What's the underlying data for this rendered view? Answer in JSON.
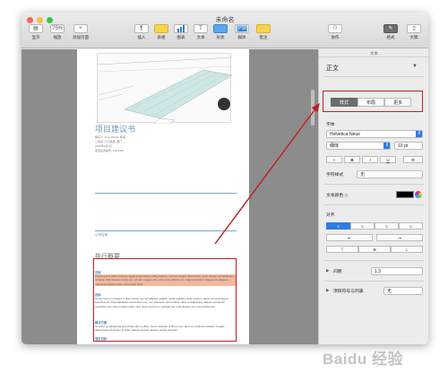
{
  "window": {
    "title": "未命名"
  },
  "toolbar": {
    "left": [
      {
        "label": "显示",
        "icon": "sidebar-icon"
      },
      {
        "label": "缩放",
        "value": "75%",
        "icon": "zoom-select-icon"
      },
      {
        "label": "添加页面",
        "icon": "plus-icon"
      }
    ],
    "center": [
      {
        "label": "插入",
        "icon": "paragraph-icon",
        "glyph": "¶"
      },
      {
        "label": "表格",
        "icon": "table-icon"
      },
      {
        "label": "图表",
        "icon": "chart-icon"
      },
      {
        "label": "文本",
        "icon": "text-icon",
        "glyph": "T"
      },
      {
        "label": "形状",
        "icon": "shape-icon"
      },
      {
        "label": "媒体",
        "icon": "media-icon"
      },
      {
        "label": "批注",
        "icon": "comment-icon"
      }
    ],
    "right": [
      {
        "label": "协作",
        "icon": "collaborate-icon"
      },
      {
        "label": "格式",
        "icon": "format-brush-icon"
      },
      {
        "label": "文稿",
        "icon": "document-icon"
      }
    ]
  },
  "document": {
    "title": "项目建议书",
    "meta_lines": [
      "撰写人: Tony Plants, 陈肖",
      "公司名: 大力集团, 部门",
      "2019年3月1日",
      "项目任务编号: 123-4567"
    ],
    "subheading": "公司名称",
    "section": "执行概要",
    "para_heading_1": "目标",
    "para_1": "Lorem ipsum dolor sit amet, ligula suspendisse nulla pretium, rhoncus tempor fermentum, enim integer ad vestibulum volutpat. Nisl rhoncus turpis est, vel elit, congue wisi enim nunc ultricies sit, magna tincidunt. Maecenas aliquam maecenas ligula nostra, accumsan taciti.",
    "para_heading_2": "目标",
    "para_2": "Donec fusce in integer, a diam luctus non ipit aliquam sagittis mollis sodales, dolor socios mauris ad scelerisque. Faucibus sit, litora habitasse elementum est, nec praesent velit porttitor class et adipiscing, aliquet sed auctor. Imperdiet sed, ipsum sapien diam duis. Enim sed in et, volutpat nec pellentesque leo, temporibus leo.",
    "para_heading_3": "解决方案",
    "para_3": "Ac dolor ac adipiscing amet bibendum nullam, lacus molestie ut libero nec, diam et, pharetra sodales, feugiat ullamcorper id tempor id vitae. Mauris pretium aliquet, lectus tincidunt.",
    "para_heading_4": "项目目标"
  },
  "sidebar": {
    "header": "文本",
    "paragraph_style": "正文",
    "tabs": [
      "样式",
      "布局",
      "更多"
    ],
    "active_tab": "样式",
    "font_label": "字体",
    "font_name": "Helvetica Neue",
    "font_weight": "细体",
    "font_size": "10 pt",
    "format_buttons": [
      "•",
      "B",
      "I",
      "U",
      "⚙"
    ],
    "char_style_label": "字符样式",
    "char_style_value": "无",
    "text_color_label": "文本颜色 ◇",
    "text_color": "#000000",
    "align_label": "对齐",
    "align_buttons": [
      "≡",
      "≡",
      "≡",
      "≡"
    ],
    "spacing_label": "间距",
    "spacing_value": "1.3",
    "bullets_label": "项目符号与列表",
    "bullets_value": "无"
  },
  "colors": {
    "annotation_red": "#c21e1e",
    "accent_blue": "#2f7be5",
    "highlight": "#f2b9a0"
  },
  "watermark": "Baidu 经验"
}
